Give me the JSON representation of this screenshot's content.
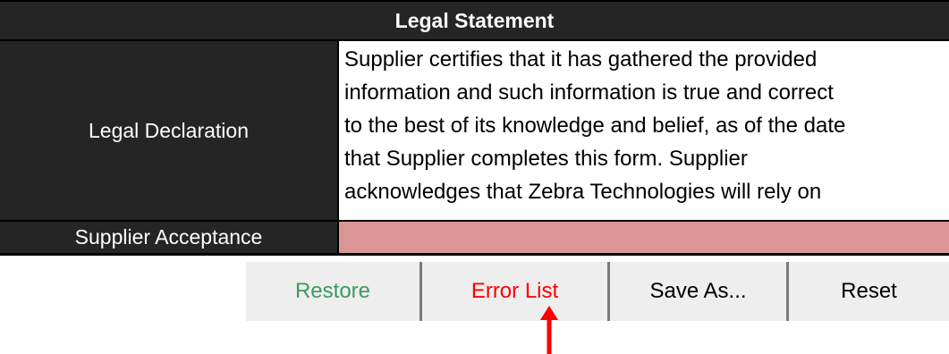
{
  "sheet": {
    "header_title": "Legal Statement",
    "declaration_label": "Legal Declaration",
    "declaration_lines": [
      "Supplier certifies that it has gathered the provided",
      "information and such information is true and correct",
      "to the best of its knowledge and belief, as of the date",
      "that Supplier completes this form. Supplier",
      "acknowledges that Zebra Technologies will rely on"
    ],
    "acceptance_label": "Supplier Acceptance",
    "acceptance_value": ""
  },
  "buttons": {
    "restore_label": "Restore",
    "error_list_label": "Error List",
    "save_as_label": "Save As...",
    "reset_label": "Reset"
  },
  "colors": {
    "header_bg": "#252525",
    "acceptance_fill": "#da9694",
    "restore_text": "#3c9a5f",
    "error_text": "#ff0000",
    "annotation_arrow": "#ff0000"
  },
  "annotation": {
    "icon": "red-up-arrow-icon"
  }
}
